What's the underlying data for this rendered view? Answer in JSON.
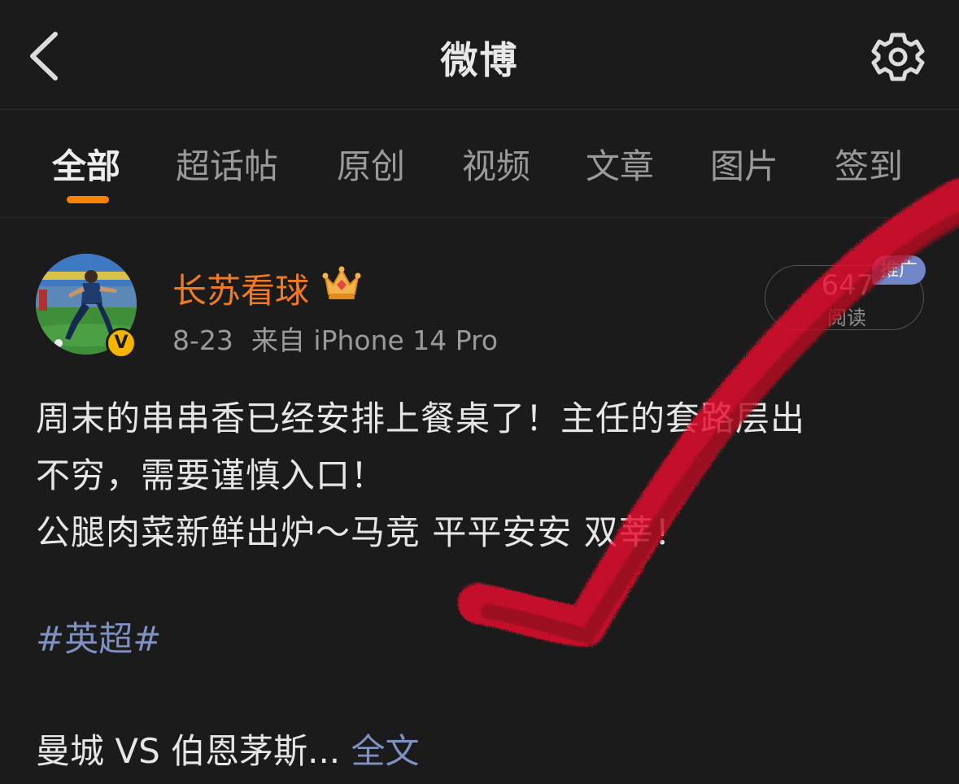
{
  "header": {
    "title": "微博",
    "back_icon": "chevron-left-icon",
    "settings_icon": "gear-icon"
  },
  "tabs": [
    {
      "label": "全部",
      "active": true
    },
    {
      "label": "超话帖"
    },
    {
      "label": "原创"
    },
    {
      "label": "视频"
    },
    {
      "label": "文章"
    },
    {
      "label": "图片"
    },
    {
      "label": "签到"
    }
  ],
  "post": {
    "author": "长苏看球",
    "date": "8-23",
    "source": "来自 iPhone 14 Pro",
    "read_count": "647",
    "read_label": "阅读",
    "promo_label": "推广",
    "verified_mark": "V",
    "lines": [
      "周末的串串香已经安排上餐桌了！主任的套路层出",
      "不穷，需要谨慎入口！",
      "公腿肉菜新鲜出炉～马竞 平平安安 双莘！"
    ],
    "hashtag": "#英超#",
    "match_text": "曼城 VS 伯恩茅斯... ",
    "full_text_link": "全文"
  },
  "colors": {
    "background": "#1b1b1b",
    "accent": "#ff8200",
    "username": "#f07a24",
    "link": "#7f91c2",
    "promo": "#6f86c9",
    "verified": "#f5b400",
    "annotation_mark": "#e8102e"
  }
}
